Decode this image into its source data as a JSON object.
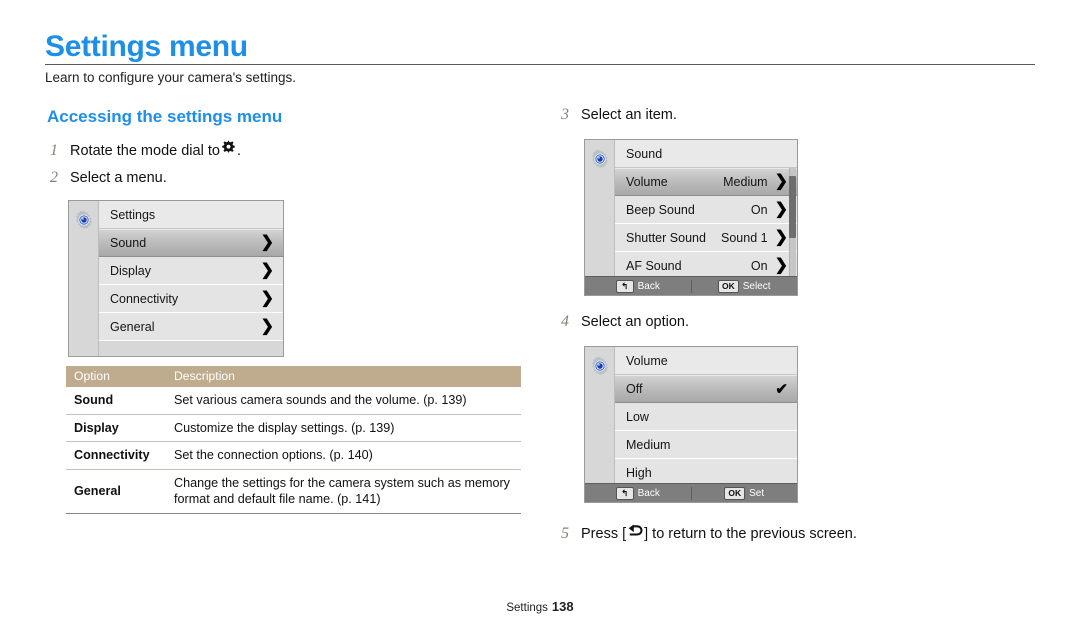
{
  "page": {
    "title": "Settings menu",
    "subtitle": "Learn to configure your camera's settings.",
    "section_heading": "Accessing the settings menu",
    "footer_label": "Settings",
    "footer_page": "138",
    "accent_color": "#1d8fe8",
    "table_header_color": "#bfab8d"
  },
  "steps": {
    "s1": {
      "num": "1",
      "before": "Rotate the mode dial to",
      "icon": "gear-icon",
      "after": "."
    },
    "s2": {
      "num": "2",
      "text": "Select a menu."
    },
    "s3": {
      "num": "3",
      "text": "Select an item."
    },
    "s4": {
      "num": "4",
      "text": "Select an option."
    },
    "s5": {
      "num": "5",
      "before": "Press [",
      "icon": "back-arrow-icon",
      "after": "] to return to the previous screen."
    }
  },
  "screens": {
    "settings": {
      "rail_icon": "settings-gear-icon",
      "header": "Settings",
      "rows": [
        {
          "label": "Sound",
          "value": "",
          "selected": true,
          "chevron": "❯"
        },
        {
          "label": "Display",
          "value": "",
          "selected": false,
          "chevron": "❯"
        },
        {
          "label": "Connectivity",
          "value": "",
          "selected": false,
          "chevron": "❯"
        },
        {
          "label": "General",
          "value": "",
          "selected": false,
          "chevron": "❯"
        }
      ],
      "has_footer": false,
      "has_scrollbar": false
    },
    "sound": {
      "rail_icon": "settings-gear-icon",
      "header": "Sound",
      "rows": [
        {
          "label": "Volume",
          "value": "Medium",
          "selected": true,
          "chevron": "❯"
        },
        {
          "label": "Beep Sound",
          "value": "On",
          "selected": false,
          "chevron": "❯"
        },
        {
          "label": "Shutter Sound",
          "value": "Sound 1",
          "selected": false,
          "chevron": "❯"
        },
        {
          "label": "AF Sound",
          "value": "On",
          "selected": false,
          "chevron": "❯"
        }
      ],
      "has_footer": true,
      "has_scrollbar": true,
      "footer": {
        "back_key": "↰",
        "back_label": "Back",
        "ok_key": "OK",
        "ok_label": "Select"
      }
    },
    "volume": {
      "rail_icon": "settings-gear-icon",
      "header": "Volume",
      "rows": [
        {
          "label": "Off",
          "value": "",
          "selected": true,
          "check": "✔"
        },
        {
          "label": "Low",
          "value": "",
          "selected": false
        },
        {
          "label": "Medium",
          "value": "",
          "selected": false
        },
        {
          "label": "High",
          "value": "",
          "selected": false
        }
      ],
      "has_footer": true,
      "has_scrollbar": false,
      "footer": {
        "back_key": "↰",
        "back_label": "Back",
        "ok_key": "OK",
        "ok_label": "Set"
      }
    }
  },
  "options_table": {
    "headers": [
      "Option",
      "Description"
    ],
    "rows": [
      [
        "Sound",
        "Set various camera sounds and the volume. (p. 139)"
      ],
      [
        "Display",
        "Customize the display settings. (p. 139)"
      ],
      [
        "Connectivity",
        "Set the connection options. (p. 140)"
      ],
      [
        "General",
        "Change the settings for the camera system such as memory format and default file name. (p. 141)"
      ]
    ]
  }
}
